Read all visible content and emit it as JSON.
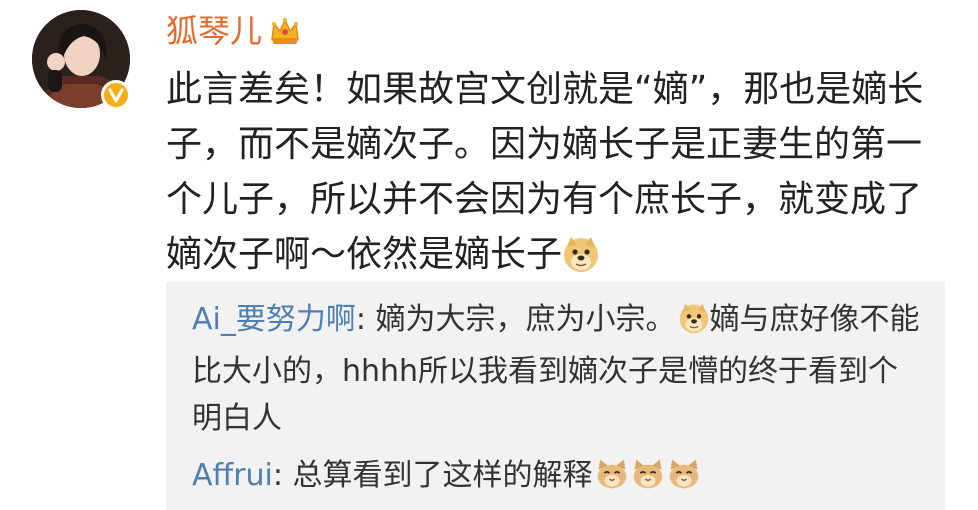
{
  "post": {
    "username": "狐琴儿",
    "username_color": "#e8692c",
    "user_badge_icon": "crown-icon",
    "avatar_badge_icon": "verified-v-icon",
    "text": "此言差矣！如果故宫文创就是“嫡”，那也是嫡长子，而不是嫡次子。因为嫡长子是正妻生的第一个儿子，所以并不会因为有个庶长子，就变成了嫡次子啊～依然是嫡长子",
    "trailing_emoji": "doge-emoji"
  },
  "comments": [
    {
      "author": "Ai_要努力啊",
      "separator": ": ",
      "text_before_emoji": "嫡为大宗，庶为小宗。",
      "emoji": "doge-emoji",
      "text_after_emoji": "嫡与庶好像不能比大小的，hhhh所以我看到嫡次子是懵的终于看到个明白人"
    },
    {
      "author": "Affrui",
      "separator": ": ",
      "text": "总算看到了这样的解释",
      "emojis": [
        "cat-emoji",
        "cat-emoji",
        "cat-emoji"
      ]
    }
  ],
  "colors": {
    "author_link": "#4f7fb0",
    "comment_background": "#f2f2f2",
    "verified_badge": "#f7ad15"
  }
}
